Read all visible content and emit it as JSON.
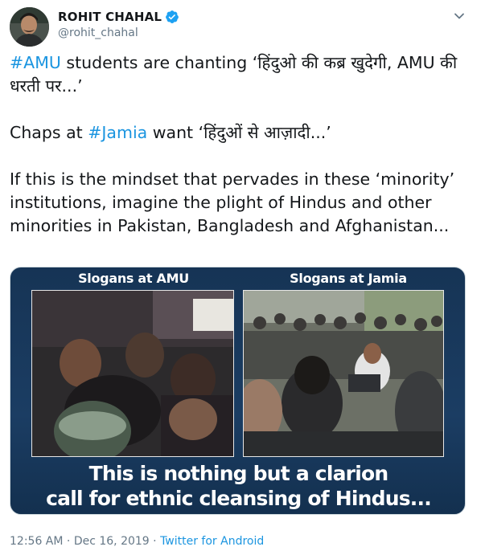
{
  "user": {
    "name": "ROHIT CHAHAL",
    "handle": "@rohit_chahal"
  },
  "tweet": {
    "line1_hashtag": "#AMU",
    "line1_text": " students are chanting ‘हिंदुओ की कब्र खुदेगी, AMU की धरती पर...’",
    "line2_prefix": "Chaps at ",
    "line2_hashtag": "#Jamia",
    "line2_text": " want ‘हिंदुओं से आज़ादी...’",
    "line3_text": "If this is the mindset that pervades in these ‘minority’ institutions, imagine the plight of Hindus and other minorities in Pakistan, Bangladesh and Afghanistan..."
  },
  "media": {
    "label_left": "Slogans at AMU",
    "label_right": "Slogans at Jamia",
    "caption_line1": "This is nothing but a clarion",
    "caption_line2": "call for ethnic cleansing of Hindus..."
  },
  "meta": {
    "time": "12:56 AM",
    "separator": " · ",
    "date": "Dec 16, 2019",
    "separator2": " · ",
    "source": "Twitter for Android"
  },
  "colors": {
    "link": "#1b95e0",
    "text": "#14171a",
    "secondary": "#657786",
    "media_bg": "#1b3d63"
  },
  "icons": [
    "avatar-image",
    "verified-badge-icon",
    "chevron-down-icon"
  ]
}
